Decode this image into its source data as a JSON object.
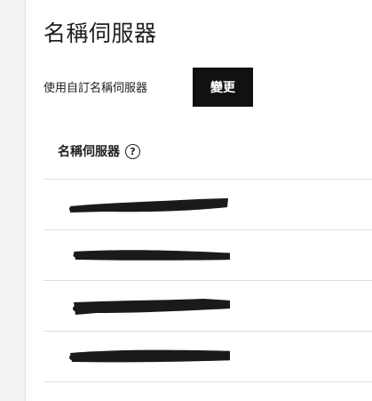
{
  "section": {
    "title": "名稱伺服器",
    "custom_label": "使用自訂名稱伺服器",
    "change_button": "變更"
  },
  "table": {
    "header": "名稱伺服器",
    "help_icon_glyph": "?",
    "rows_note": "values redacted",
    "row_count": 4
  },
  "colors": {
    "button_bg": "#111111",
    "redaction": "#1a1a1a",
    "divider": "#dadce0"
  }
}
